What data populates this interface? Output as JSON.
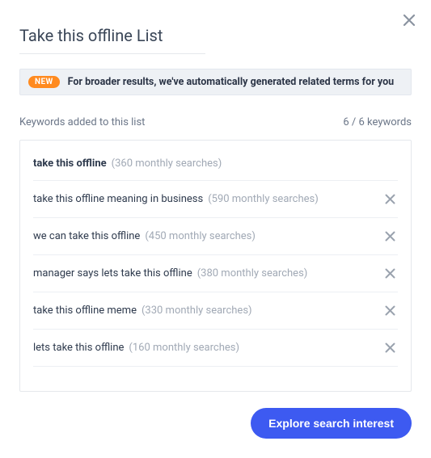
{
  "modal": {
    "title": "Take this offline List",
    "notice_badge": "NEW",
    "notice_text": "For broader results, we've automatically generated related terms for you",
    "keywords_label": "Keywords added to this list",
    "keywords_count": "6 / 6 keywords",
    "cta_label": "Explore search interest"
  },
  "keywords": [
    {
      "term": "take this offline",
      "meta": "(360 monthly searches)",
      "bold": true,
      "removable": false
    },
    {
      "term": "take this offline meaning in business",
      "meta": "(590 monthly searches)",
      "bold": false,
      "removable": true
    },
    {
      "term": "we can take this offline",
      "meta": "(450 monthly searches)",
      "bold": false,
      "removable": true
    },
    {
      "term": "manager says lets take this offline",
      "meta": "(380 monthly searches)",
      "bold": false,
      "removable": true
    },
    {
      "term": "take this offline meme",
      "meta": "(330 monthly searches)",
      "bold": false,
      "removable": true
    },
    {
      "term": "lets take this offline",
      "meta": "(160 monthly searches)",
      "bold": false,
      "removable": true
    }
  ]
}
